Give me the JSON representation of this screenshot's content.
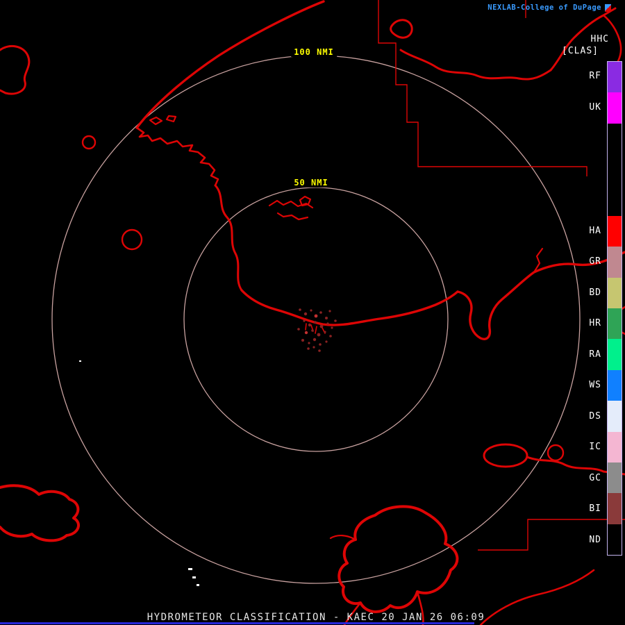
{
  "header": {
    "brand": "NEXLAB-College of DuPage",
    "product_code": "HHC",
    "product_mode": "[CLAS]"
  },
  "rings": {
    "outer_label": "100 NMI",
    "inner_label": "50 NMI"
  },
  "legend": {
    "segments": [
      {
        "label": "RF",
        "color": "#8A2BE2",
        "span": 1
      },
      {
        "label": "UK",
        "color": "#FF00FF",
        "span": 1
      },
      {
        "label": "",
        "color": "#000000",
        "span": 3
      },
      {
        "label": "HA",
        "color": "#FF0000",
        "span": 1
      },
      {
        "label": "GR",
        "color": "#C08890",
        "span": 1
      },
      {
        "label": "BD",
        "color": "#C6C670",
        "span": 1
      },
      {
        "label": "HR",
        "color": "#2FA456",
        "span": 1
      },
      {
        "label": "RA",
        "color": "#00F08C",
        "span": 1
      },
      {
        "label": "WS",
        "color": "#1080FF",
        "span": 1
      },
      {
        "label": "DS",
        "color": "#E4ECFA",
        "span": 1
      },
      {
        "label": "IC",
        "color": "#F4B6D2",
        "span": 1
      },
      {
        "label": "GC",
        "color": "#8C8C8C",
        "span": 1
      },
      {
        "label": "BI",
        "color": "#8A3A3A",
        "span": 1
      },
      {
        "label": "ND",
        "color": "#000000",
        "span": 1
      }
    ]
  },
  "footer": {
    "caption": "HYDROMETEOR CLASSIFICATION - KAEC 20 JAN 26 06:09"
  },
  "colors": {
    "map_line": "#DD0505",
    "ring": "#C9A2A0",
    "ring_label": "#FFFF00",
    "brand_text": "#3A9BFF",
    "footer_text": "#E8E8E8",
    "legend_border": "#C4B4F0",
    "bottom_bar": "#2626D8",
    "echo": "#8B2222",
    "echo_bright": "#C23030",
    "speck": "#FFFFFF"
  }
}
